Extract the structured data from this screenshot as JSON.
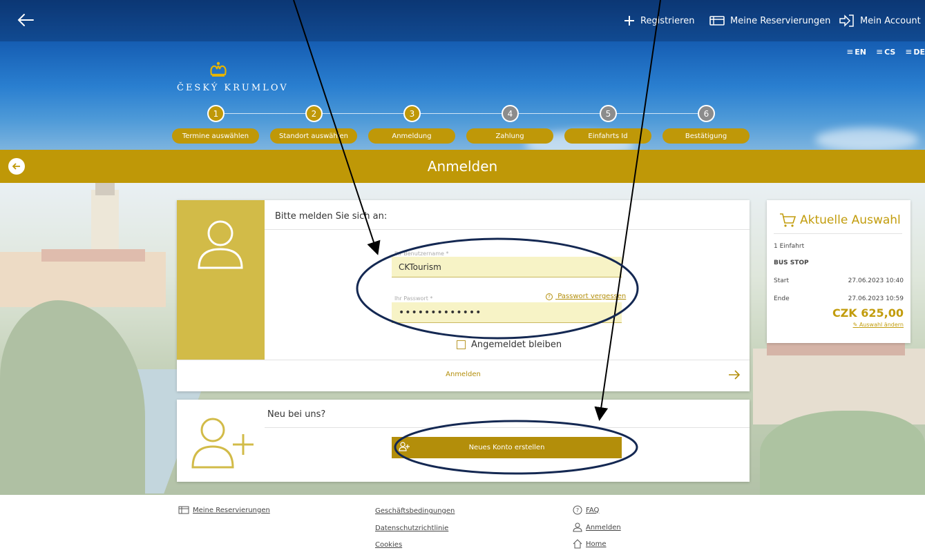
{
  "header": {
    "register_label": "Registrieren",
    "reservations_label": "Meine Reservierungen",
    "account_label": "Mein Account",
    "languages": [
      "EN",
      "CS",
      "DE"
    ]
  },
  "logo": {
    "text": "ČESKÝ KRUMLOV"
  },
  "steps": [
    {
      "number": "1",
      "label": "Termine auswählen",
      "state": "active"
    },
    {
      "number": "2",
      "label": "Standort auswählen",
      "state": "active"
    },
    {
      "number": "3",
      "label": "Anmeldung",
      "state": "active"
    },
    {
      "number": "4",
      "label": "Zahlung",
      "state": "pending"
    },
    {
      "number": "5",
      "label": "Einfahrts Id",
      "state": "pending"
    },
    {
      "number": "6",
      "label": "Bestätigung",
      "state": "pending"
    }
  ],
  "page_title": "Anmelden",
  "login": {
    "heading": "Bitte melden Sie sich an:",
    "username_label": "Ihr Benutzername *",
    "username_value": "CKTourism",
    "password_label": "Ihr Passwort *",
    "password_value": "•••••••••••••",
    "forgot_label": "Passwort vergessen",
    "remember_label": "Angemeldet bleiben",
    "submit_label": "Anmelden"
  },
  "register": {
    "heading": "Neu bei uns?",
    "button_label": "Neues Konto erstellen"
  },
  "summary": {
    "title": "Aktuelle Auswahl",
    "count": "1 Einfahrt",
    "stop": "BUS STOP",
    "start_label": "Start",
    "start_value": "27.06.2023 10:40",
    "end_label": "Ende",
    "end_value": "27.06.2023 10:59",
    "price": "CZK 625,00",
    "change_label": "Auswahl ändern"
  },
  "footer": {
    "reservations": "Meine Reservierungen",
    "terms": "Geschäftsbedingungen",
    "privacy": "Datenschutzrichtlinie",
    "cookies": "Cookies",
    "faq": "FAQ",
    "login": "Anmelden",
    "home": "Home"
  },
  "colors": {
    "gold": "#bf9808",
    "dark_gold": "#b38e0a",
    "sky_blue": "#1760b5",
    "annotation_navy": "#142852"
  }
}
